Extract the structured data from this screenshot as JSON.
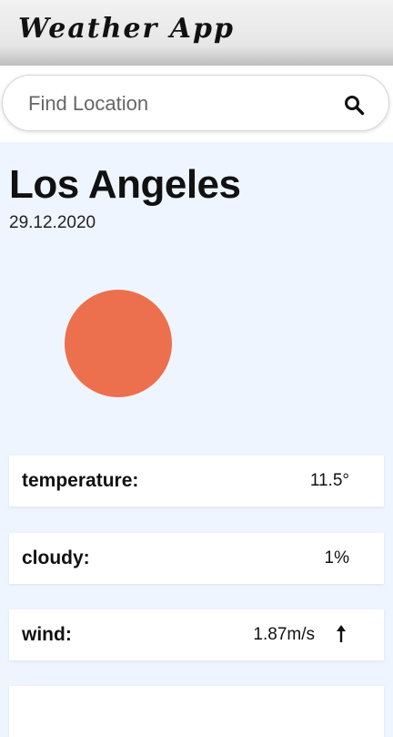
{
  "header": {
    "title": "Weather App"
  },
  "search": {
    "placeholder": "Find Location",
    "value": "",
    "icon": "search-icon"
  },
  "location": {
    "city": "Los Angeles",
    "date": "29.12.2020"
  },
  "current_weather": {
    "icon": "sun-icon",
    "icon_color": "#ec704d"
  },
  "details": [
    {
      "label": "temperature:",
      "value": "11.5°"
    },
    {
      "label": "cloudy:",
      "value": "1%"
    },
    {
      "label": "wind:",
      "value": "1.87m/s",
      "direction_icon": "wind-direction-arrow-icon"
    }
  ],
  "colors": {
    "background": "#eef5ff",
    "card": "#ffffff",
    "text": "#111111"
  }
}
